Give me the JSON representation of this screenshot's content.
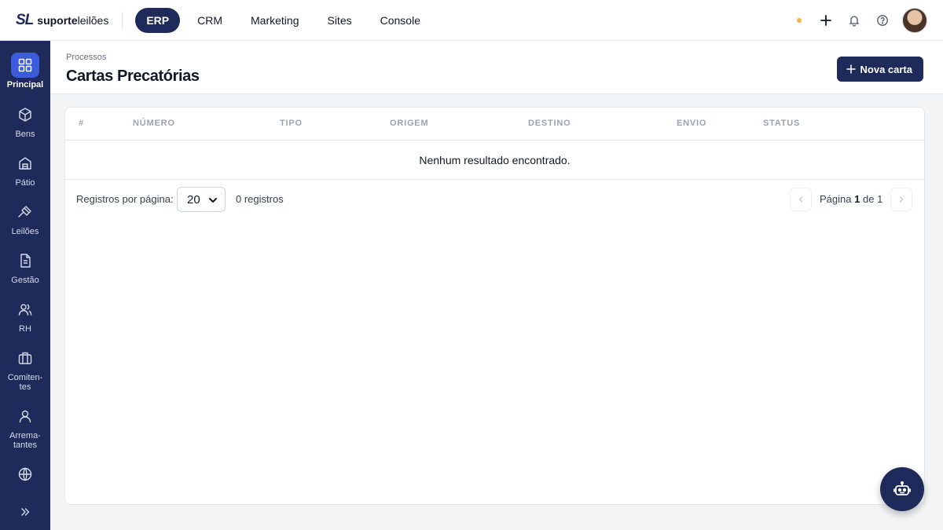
{
  "brand": {
    "mark": "SL",
    "name_bold": "suporte",
    "name_light": "leilões"
  },
  "top_nav": [
    {
      "label": "ERP",
      "active": true
    },
    {
      "label": "CRM",
      "active": false
    },
    {
      "label": "Marketing",
      "active": false
    },
    {
      "label": "Sites",
      "active": false
    },
    {
      "label": "Console",
      "active": false
    }
  ],
  "top_actions": {
    "status_dot_color": "#f5b548",
    "icons": [
      "plus-icon",
      "bell-icon",
      "help-icon",
      "avatar"
    ]
  },
  "sidebar": {
    "items": [
      {
        "label": "Principal",
        "icon": "grid-icon",
        "active": true
      },
      {
        "label": "Bens",
        "icon": "box-icon"
      },
      {
        "label": "Pátio",
        "icon": "warehouse-icon"
      },
      {
        "label": "Leilões",
        "icon": "gavel-icon"
      },
      {
        "label": "Gestão",
        "icon": "document-icon"
      },
      {
        "label": "RH",
        "icon": "users-icon"
      },
      {
        "label": "Comiten-\ntes",
        "icon": "briefcase-icon"
      },
      {
        "label": "Arrema-\ntantes",
        "icon": "user-icon"
      },
      {
        "label": "",
        "icon": "globe-icon"
      }
    ],
    "toggle_icon": "chevrons-right-icon"
  },
  "header": {
    "breadcrumb": "Processos",
    "title": "Cartas Precatórias",
    "new_button": "Nova carta"
  },
  "table": {
    "columns": [
      "#",
      "NÚMERO",
      "TIPO",
      "ORIGEM",
      "DESTINO",
      "ENVIO",
      "STATUS"
    ],
    "rows": [],
    "empty_message": "Nenhum resultado encontrado."
  },
  "pagination": {
    "per_page_label": "Registros por página:",
    "per_page_value": "20",
    "records": "0 registros",
    "page_word": "Página",
    "current_page": "1",
    "of_word": "de",
    "total_pages": "1"
  },
  "colors": {
    "brand_navy": "#1e2a5a",
    "active_blue": "#3b5bdb"
  }
}
